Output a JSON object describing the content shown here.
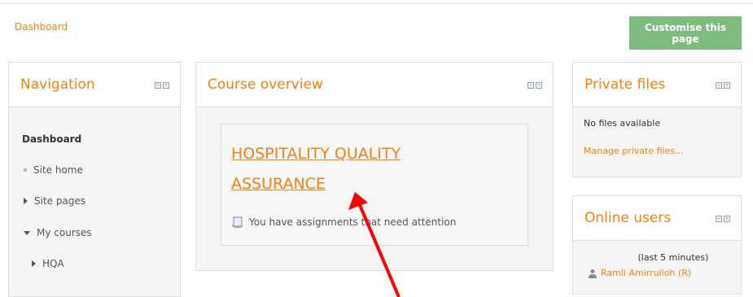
{
  "breadcrumb": {
    "label": "Dashboard"
  },
  "header": {
    "customise_label": "Customise this page"
  },
  "navigation": {
    "title": "Navigation",
    "dashboard": "Dashboard",
    "items": [
      {
        "label": "Site home"
      },
      {
        "label": "Site pages"
      },
      {
        "label": "My courses"
      },
      {
        "label": "HQA"
      }
    ]
  },
  "course_overview": {
    "title": "Course overview",
    "course_title": "HOSPITALITY QUALITY ASSURANCE",
    "assignment_notice": "You have assignments that need attention"
  },
  "private_files": {
    "title": "Private files",
    "status": "No files available",
    "manage_link": "Manage private files..."
  },
  "online_users": {
    "title": "Online users",
    "window": "(last 5 minutes)",
    "users": [
      {
        "name": "Ramli Amirrulloh (R)"
      }
    ]
  },
  "colors": {
    "accent": "#f98012",
    "button": "#7fba7f",
    "arrow": "#ff0000"
  },
  "icons": {
    "block_controls": [
      "hide-block-icon",
      "dock-block-icon"
    ]
  }
}
